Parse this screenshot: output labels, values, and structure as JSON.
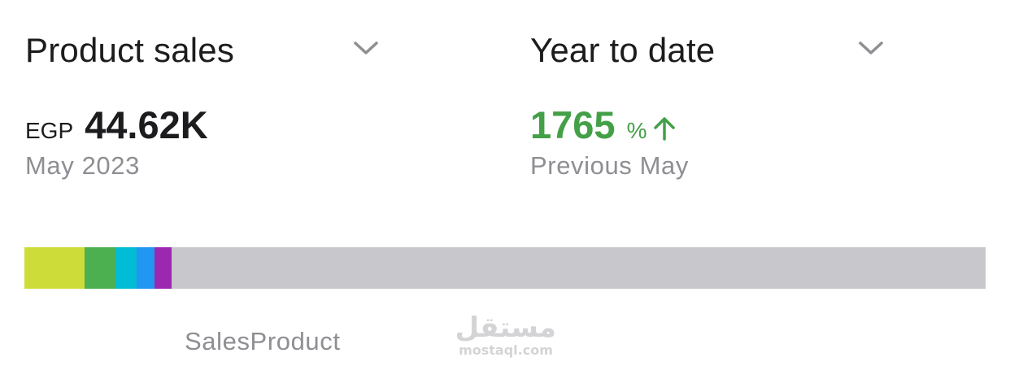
{
  "metric_dropdown": {
    "label": "Product sales",
    "icon": "chevron-down-icon"
  },
  "period_dropdown": {
    "label": "Year to date",
    "icon": "chevron-down-icon"
  },
  "left_metric": {
    "currency": "EGP",
    "value": "44.62K",
    "period": "May 2023"
  },
  "right_metric": {
    "value": "1765",
    "percent_sign": "%",
    "trend_icon": "arrow-up-icon",
    "comparison": "Previous May",
    "color": "#43a047"
  },
  "breakdown_bar": {
    "segments": [
      {
        "color": "#cddc39",
        "share": 0.0625
      },
      {
        "color": "#4caf50",
        "share": 0.032
      },
      {
        "color": "#00bcd4",
        "share": 0.022
      },
      {
        "color": "#2196f3",
        "share": 0.019
      },
      {
        "color": "#9c27b0",
        "share": 0.018
      }
    ],
    "remainder_color": "#c7c7cc",
    "caption": "SalesProduct"
  },
  "watermark": {
    "logo_text": "مستقل",
    "domain": "mostaql.com"
  }
}
